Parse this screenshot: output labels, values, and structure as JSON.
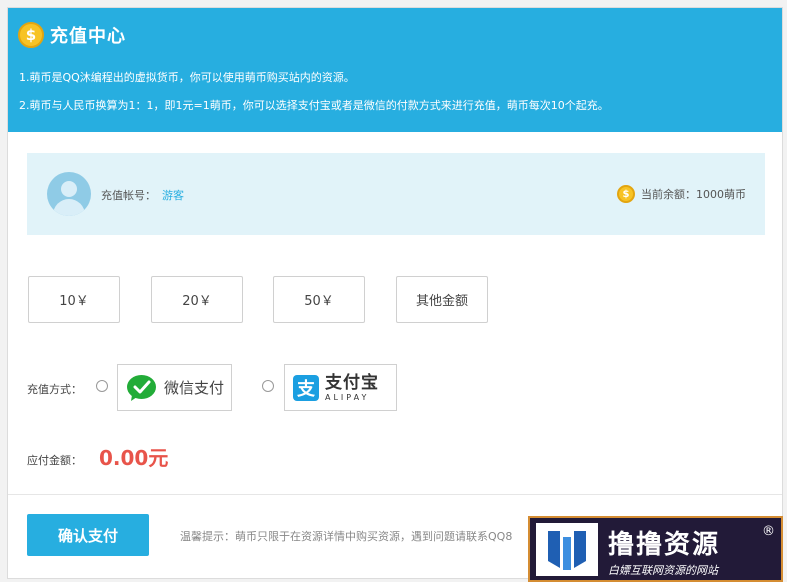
{
  "header": {
    "title": "充值中心",
    "coin_symbol": "$",
    "line1": "1.萌币是QQ沐编程出的虚拟货币，你可以使用萌币购买站内的资源。",
    "line2": "2.萌币与人民币换算为1：1，即1元=1萌币，你可以选择支付宝或者是微信的付款方式来进行充值，萌币每次10个起充。",
    "bg_color": "#27aee0"
  },
  "account": {
    "label": "充值帐号：",
    "value": "游客",
    "balance_label": "当前余额：1000萌币",
    "coin_symbol": "$"
  },
  "amounts": [
    {
      "label": "10￥"
    },
    {
      "label": "20￥"
    },
    {
      "label": "50￥"
    },
    {
      "label": "其他金额"
    }
  ],
  "payment": {
    "label": "充值方式：",
    "wechat": {
      "label": "微信支付",
      "icon": "wechat-pay-icon"
    },
    "alipay": {
      "label_cn": "支付宝",
      "label_en": "ALIPAY",
      "icon": "alipay-icon",
      "icon_glyph": "支"
    }
  },
  "due": {
    "label": "应付金额：",
    "value": "0.00元",
    "color": "#e8544a"
  },
  "confirm_label": "确认支付",
  "tip": "温馨提示：萌币只限于在资源详情中购买资源，遇到问题请联系QQ8",
  "watermark": {
    "title": "撸撸资源",
    "reg": "®",
    "subtitle": "白嫖互联网资源的网站"
  }
}
